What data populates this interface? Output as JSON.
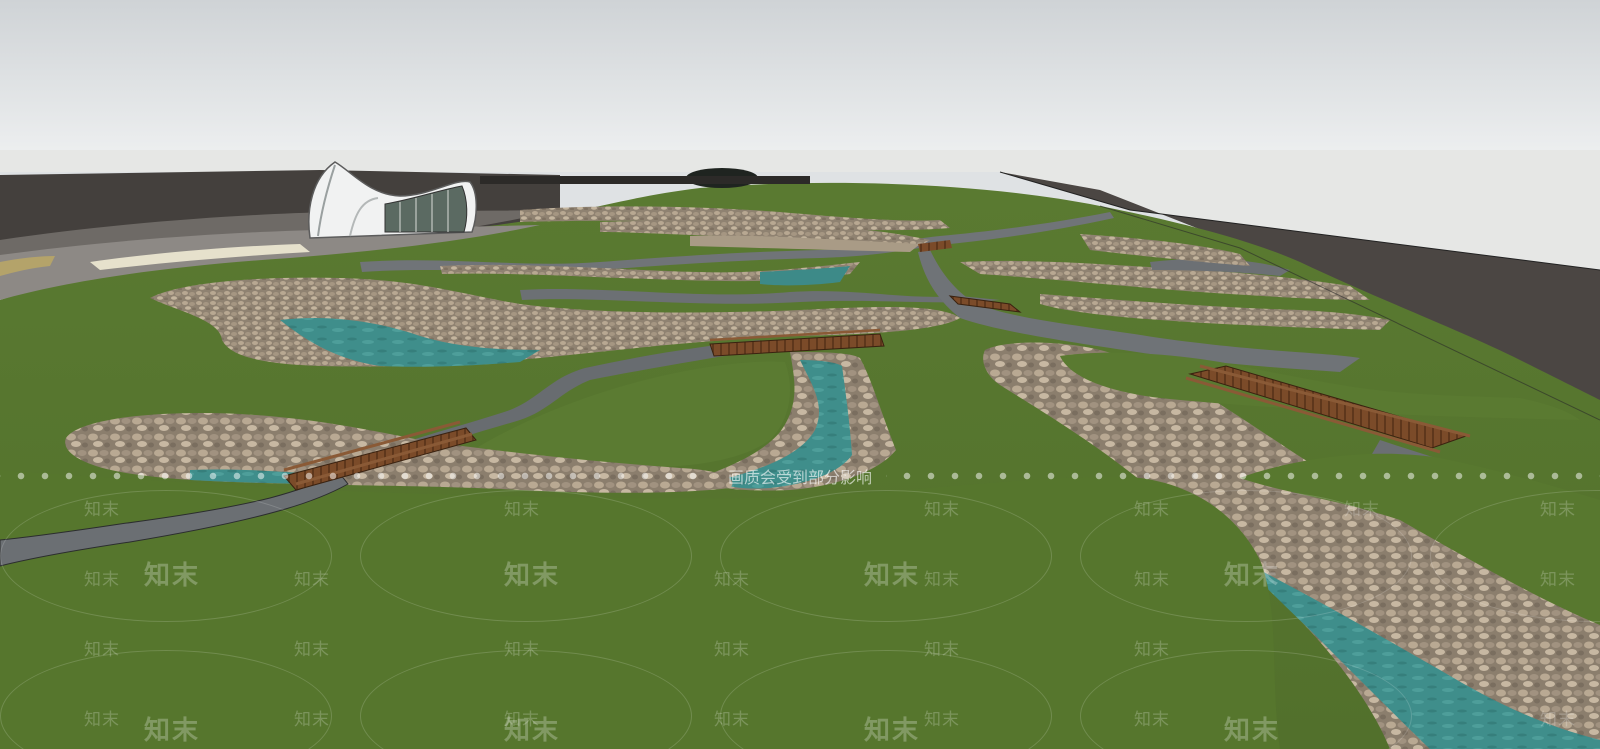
{
  "scene": {
    "description_colors": {
      "sky": "#dcdfe1",
      "grass": "#58782f",
      "water": "#3f8f8c",
      "gravel": "#9a8a76",
      "path": "#6f7478",
      "bridge": "#7a4a28",
      "ground": "#4a4542"
    }
  },
  "watermark": {
    "brand": "知末",
    "notice": "画质会受到部分影响"
  }
}
